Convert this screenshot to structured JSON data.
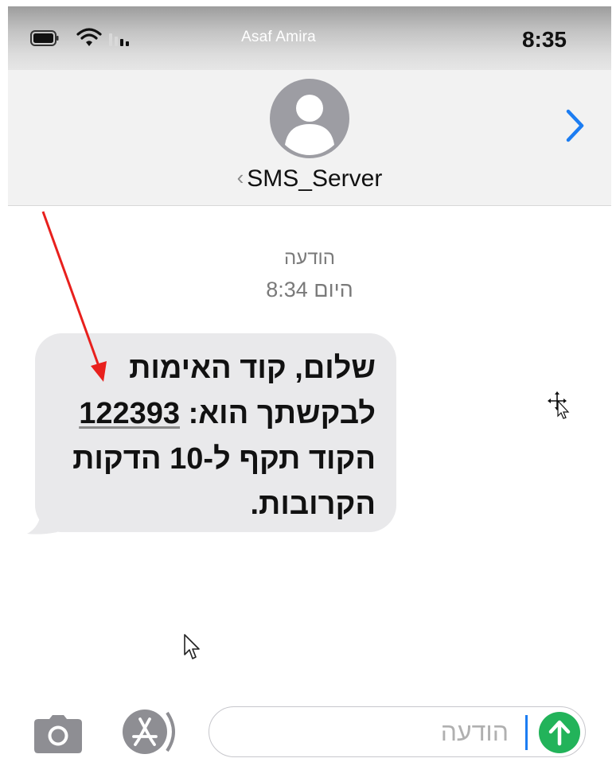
{
  "status_bar": {
    "carrier": "Asaf Amira",
    "time": "8:35"
  },
  "header": {
    "contact_name": "SMS_Server",
    "back_chevron": "‹",
    "icons": [
      "avatar-icon",
      "chevron-right-icon"
    ]
  },
  "thread": {
    "message_type": "הודעה",
    "timestamp": "היום 8:34",
    "message": {
      "line1": "שלום, קוד האימות",
      "line2_prefix": "לבקשתך הוא: ",
      "code": "122393",
      "line3": "הקוד תקף ל-10 הדקות",
      "line4": "הקרובות."
    }
  },
  "compose": {
    "placeholder": "הודעה",
    "icons": [
      "camera-icon",
      "app-store-icon",
      "send-arrow-icon"
    ]
  },
  "colors": {
    "bubble": "#e9e9eb",
    "accent_blue": "#1c7df2",
    "send_green": "#22b35a",
    "annotation_red": "#e8201d"
  }
}
